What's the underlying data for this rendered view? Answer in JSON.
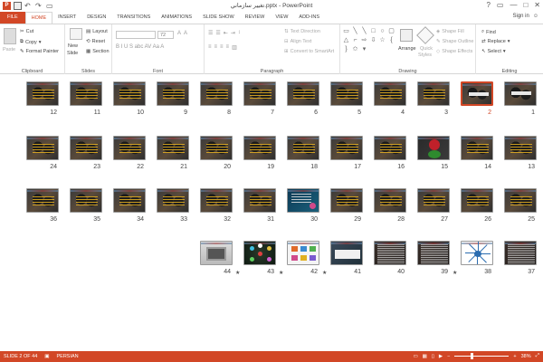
{
  "titlebar": {
    "title": "تغيير سازماني.pptx - PowerPoint",
    "help": "?",
    "min": "—",
    "max": "□",
    "close": "✕",
    "restore": "▭"
  },
  "tabs": [
    "FILE",
    "HOME",
    "INSERT",
    "DESIGN",
    "TRANSITIONS",
    "ANIMATIONS",
    "SLIDE SHOW",
    "REVIEW",
    "VIEW",
    "ADD-INS"
  ],
  "signin": "Sign in",
  "ribbon": {
    "clipboard": {
      "label": "Clipboard",
      "paste": "Paste",
      "cut": "Cut",
      "copy": "Copy",
      "format_painter": "Format Painter"
    },
    "slides": {
      "label": "Slides",
      "new_slide": "New",
      "new_slide2": "Slide",
      "layout": "Layout",
      "reset": "Reset",
      "section": "Section"
    },
    "font": {
      "label": "Font",
      "size": "72",
      "buttons": "B I U S abc AV Aa A"
    },
    "paragraph": {
      "label": "Paragraph",
      "text_direction": "Text Direction",
      "align_text": "Align Text",
      "convert": "Convert to SmartArt"
    },
    "drawing": {
      "label": "Drawing",
      "arrange": "Arrange",
      "quick_styles": "Quick",
      "quick_styles2": "Styles",
      "shape_fill": "Shape Fill",
      "shape_outline": "Shape Outline",
      "shape_effects": "Shape Effects"
    },
    "editing": {
      "label": "Editing",
      "find": "Find",
      "replace": "Replace",
      "select": "Select"
    }
  },
  "slides": [
    {
      "n": "1",
      "kind": "title"
    },
    {
      "n": "2",
      "kind": "title",
      "selected": true
    },
    {
      "n": "3"
    },
    {
      "n": "4"
    },
    {
      "n": "5"
    },
    {
      "n": "6"
    },
    {
      "n": "7"
    },
    {
      "n": "8"
    },
    {
      "n": "9"
    },
    {
      "n": "10"
    },
    {
      "n": "11"
    },
    {
      "n": "12"
    },
    {
      "n": "13"
    },
    {
      "n": "14"
    },
    {
      "n": "15",
      "kind": "t15"
    },
    {
      "n": "16"
    },
    {
      "n": "17"
    },
    {
      "n": "18"
    },
    {
      "n": "19"
    },
    {
      "n": "20"
    },
    {
      "n": "21"
    },
    {
      "n": "22"
    },
    {
      "n": "23"
    },
    {
      "n": "24"
    },
    {
      "n": "25"
    },
    {
      "n": "26"
    },
    {
      "n": "27"
    },
    {
      "n": "28"
    },
    {
      "n": "29"
    },
    {
      "n": "30",
      "kind": "t30"
    },
    {
      "n": "31"
    },
    {
      "n": "32"
    },
    {
      "n": "33"
    },
    {
      "n": "34"
    },
    {
      "n": "35"
    },
    {
      "n": "36"
    },
    {
      "n": "37",
      "kind": "t37"
    },
    {
      "n": "38",
      "kind": "t38",
      "star": true
    },
    {
      "n": "39",
      "kind": "t39"
    },
    {
      "n": "40",
      "kind": "t40"
    },
    {
      "n": "41",
      "kind": "t41",
      "star": true
    },
    {
      "n": "42",
      "kind": "t42",
      "star": true
    },
    {
      "n": "43",
      "kind": "t43",
      "star": true
    },
    {
      "n": "44",
      "kind": "t44"
    }
  ],
  "status": {
    "slide_of": "SLIDE 2 OF 44",
    "language": "PERSIAN",
    "zoom": "38%",
    "zoom_minus": "−",
    "zoom_plus": "+"
  },
  "colors": {
    "accent": "#d24726"
  }
}
